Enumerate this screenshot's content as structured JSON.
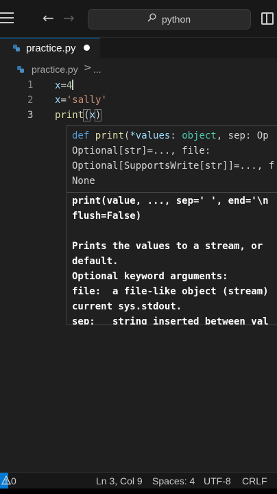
{
  "titlebar": {
    "menu_icon": "hamburger-menu-icon",
    "back_icon": "←",
    "forward_icon": "→",
    "search_text": "python",
    "layout_icon": "toggle-sidebar-icon"
  },
  "tabs": [
    {
      "label": "practice.py",
      "icon": "python-file-icon",
      "dirty": true
    }
  ],
  "breadcrumb": {
    "file": "practice.py",
    "separator": ">",
    "more": "..."
  },
  "editor": {
    "lines": [
      {
        "number": "1"
      },
      {
        "number": "2"
      },
      {
        "number": "3"
      }
    ],
    "line1": {
      "var": "x",
      "op": "=",
      "value": "4"
    },
    "line2": {
      "var": "x",
      "op": "=",
      "value": "'sally'"
    },
    "line3": {
      "fn": "print",
      "open": "(",
      "arg": "x",
      "close": ")"
    }
  },
  "hover": {
    "signature": {
      "kw": "def",
      "fn": "print",
      "open": "(",
      "star_param": "*values",
      "colon": ": ",
      "type1": "object",
      "rest1": ", sep: Op",
      "line2": "Optional[str]=..., file:",
      "line3": "Optional[SupportsWrite[str]]=..., f",
      "line4": "None"
    },
    "doc": [
      "print(value, ..., sep=' ', end='\\n",
      "flush=False)",
      "",
      "Prints the values to a stream, or",
      "default.",
      "Optional keyword arguments:",
      "file:  a file-like object (stream)",
      "current sys.stdout.",
      "sep:   string inserted between val"
    ]
  },
  "statusbar": {
    "problems": "0",
    "position": "Ln 3, Col 9",
    "spaces": "Spaces: 4",
    "encoding": "UTF-8",
    "eol": "CRLF"
  },
  "colors": {
    "accent": "#0078d4",
    "background": "#1f1f1f",
    "chrome": "#181818"
  }
}
